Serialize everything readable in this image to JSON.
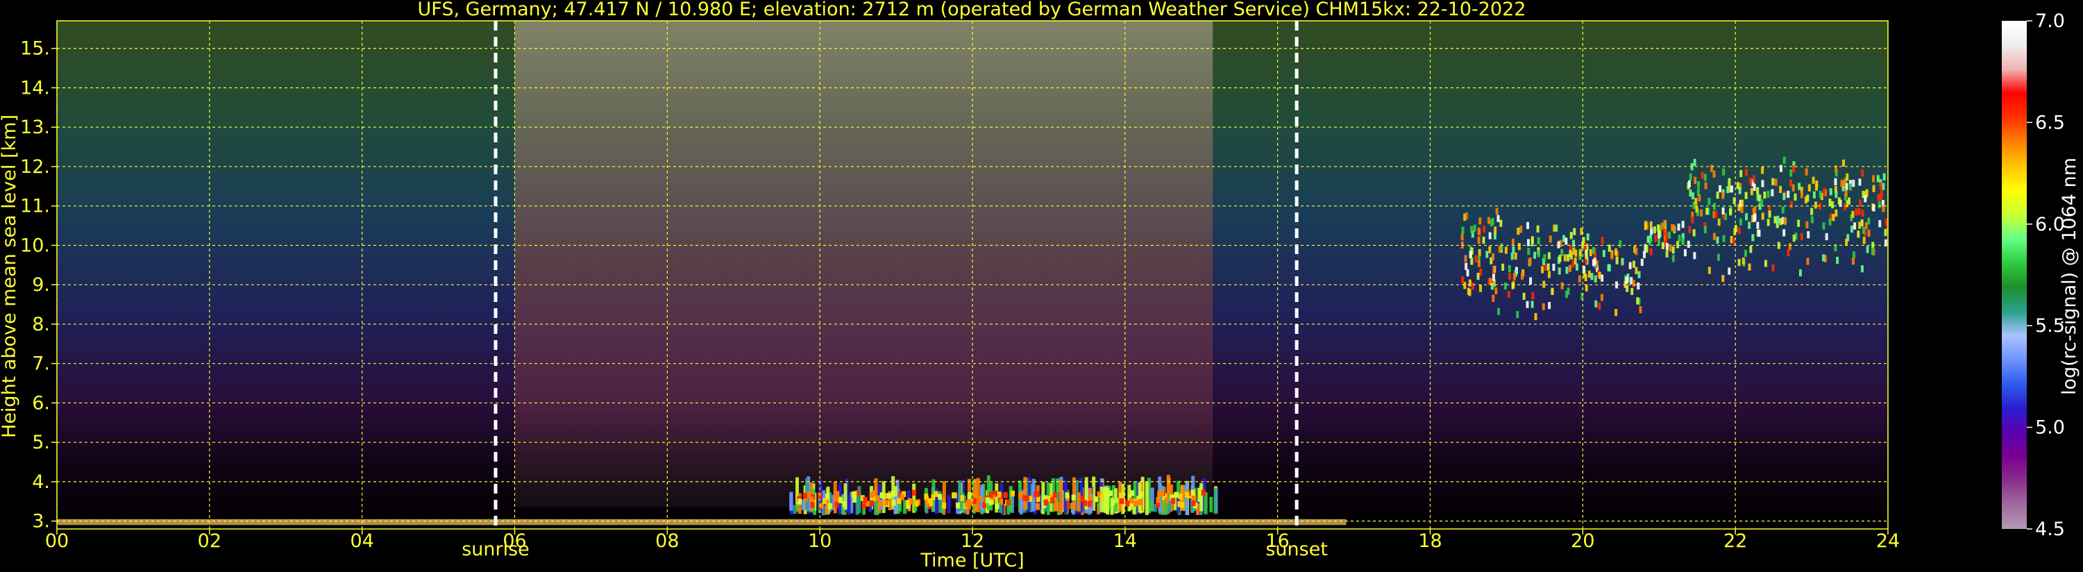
{
  "chart_data": {
    "type": "heatmap",
    "title": "UFS, Germany; 47.417 N / 10.980 E; elevation: 2712 m  (operated by German Weather Service)    CHM15kx: 22-10-2022",
    "xlabel": "Time [UTC]",
    "ylabel": "Height above mean sea level [km]",
    "colorbar_label": "log(rc-signal) @ 1064 nm",
    "xlim": [
      0,
      24
    ],
    "ylim": [
      2.8,
      15.7
    ],
    "x_ticks": [
      0,
      2,
      4,
      6,
      8,
      10,
      12,
      14,
      16,
      18,
      20,
      22,
      24
    ],
    "x_tick_labels": [
      "00",
      "02",
      "04",
      "06",
      "08",
      "10",
      "12",
      "14",
      "16",
      "18",
      "20",
      "22",
      "24"
    ],
    "y_ticks": [
      3,
      4,
      5,
      6,
      7,
      8,
      9,
      10,
      11,
      12,
      13,
      14,
      15
    ],
    "y_tick_labels": [
      "3.",
      "4.",
      "5.",
      "6.",
      "7.",
      "8.",
      "9.",
      "10.",
      "11.",
      "12.",
      "13.",
      "14.",
      "15."
    ],
    "colorbar_range": [
      4.5,
      7.0
    ],
    "colorbar_ticks": [
      4.5,
      5.0,
      5.5,
      6.0,
      6.5,
      7.0
    ],
    "colorbar_tick_labels": [
      "4.5",
      "5.0",
      "5.5",
      "6.0",
      "6.5",
      "7.0"
    ],
    "grid": true,
    "annotations": [
      {
        "label": "sunrise",
        "x": 5.75
      },
      {
        "label": "sunset",
        "x": 16.25
      }
    ],
    "colors": {
      "text": "#ffff33",
      "grid": "#ffff33",
      "background": "#000000",
      "colormap": [
        "#b39ab3",
        "#a06aa0",
        "#8a2f8a",
        "#7a0090",
        "#5a00b0",
        "#2a1fd0",
        "#2f5cf0",
        "#6f93ff",
        "#a8c3ff",
        "#2aa08c",
        "#1d8f2a",
        "#2ecc40",
        "#66ff88",
        "#ccff33",
        "#ffff00",
        "#ffc400",
        "#ff8000",
        "#ff3300",
        "#ff0000",
        "#f0b3b3",
        "#eeeeee",
        "#ffffff"
      ]
    }
  }
}
